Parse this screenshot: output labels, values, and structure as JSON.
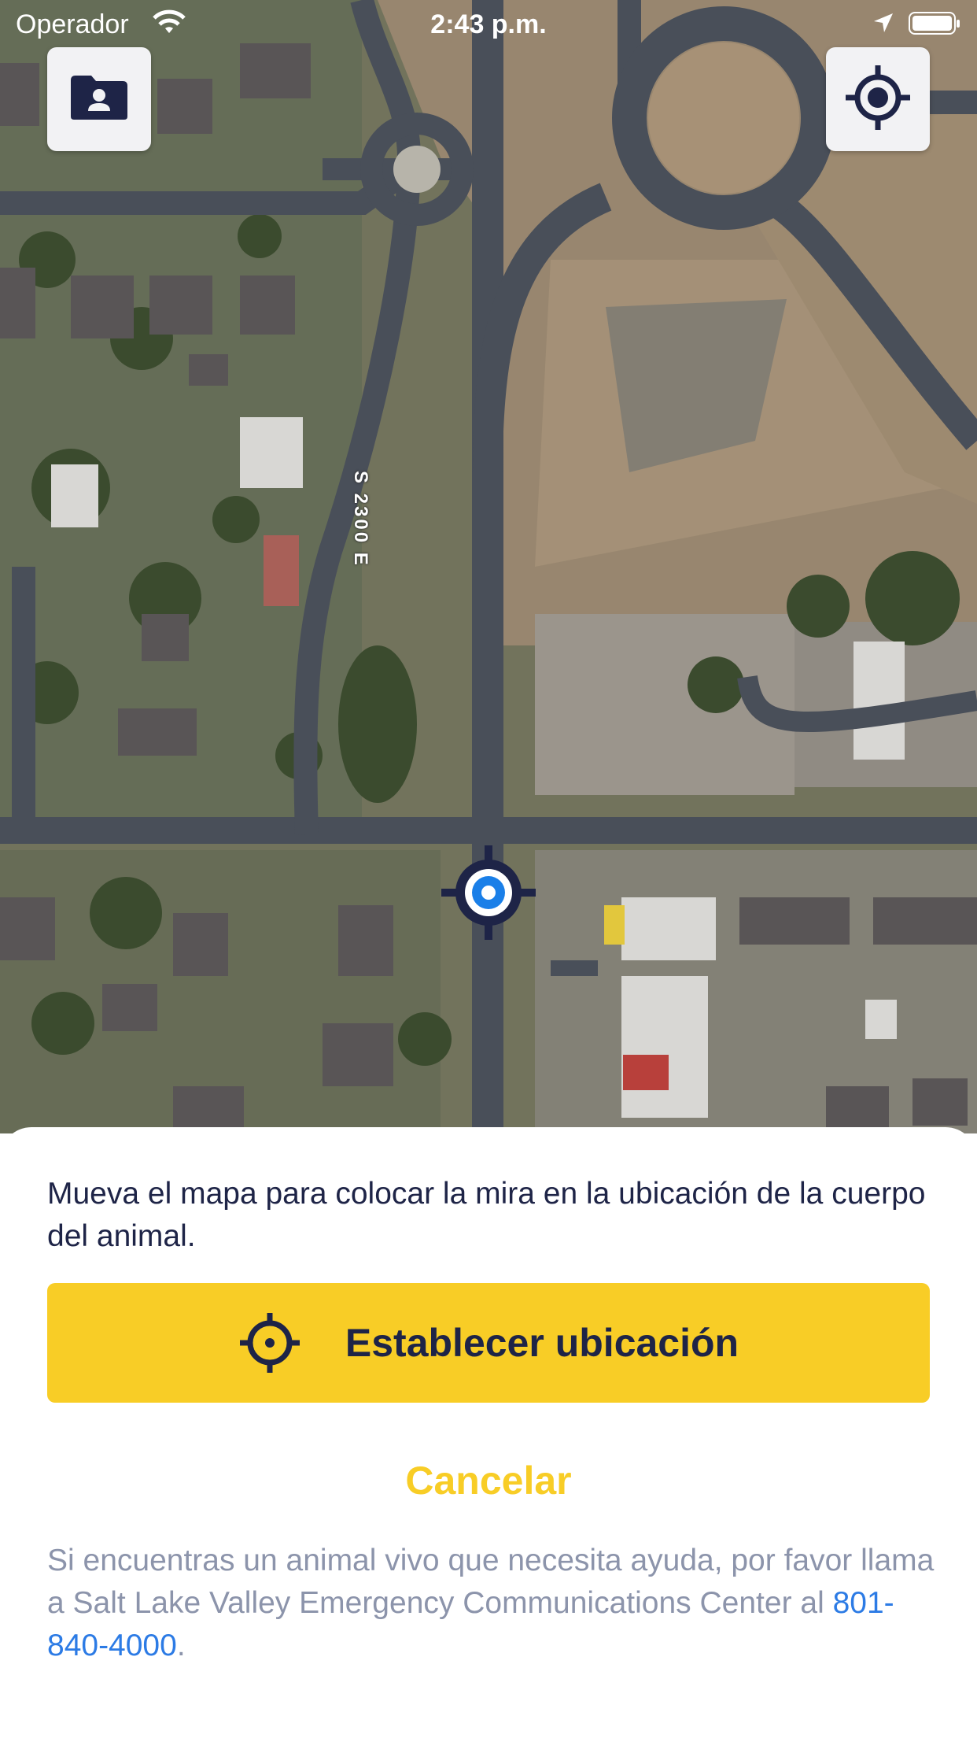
{
  "status_bar": {
    "carrier": "Operador",
    "time": "2:43 p.m.",
    "icons": [
      "wifi-icon",
      "location-arrow-icon",
      "battery-icon"
    ]
  },
  "map": {
    "road_label": "S 2300 E",
    "buttons": {
      "left_icon": "contact-folder-icon",
      "right_icon": "locate-me-icon"
    },
    "marker_icon": "crosshair-marker-icon"
  },
  "sheet": {
    "instructions": "Mueva el mapa para colocar la mira en la ubicación de la cuerpo del animal.",
    "set_location_label": "Establecer ubicación",
    "set_location_icon": "crosshair-icon",
    "cancel_label": "Cancelar",
    "help_text_prefix": "Si encuentras un animal vivo que necesita ayuda, por favor llama a Salt Lake Valley Emergency Communications Center al ",
    "help_phone": "801-840-4000",
    "help_text_suffix": "."
  },
  "colors": {
    "accent_yellow": "#f8cd26",
    "navy": "#1e2447",
    "link_blue": "#2c7be5",
    "muted_text": "#8c94ab",
    "marker_blue": "#1a7fe8"
  }
}
